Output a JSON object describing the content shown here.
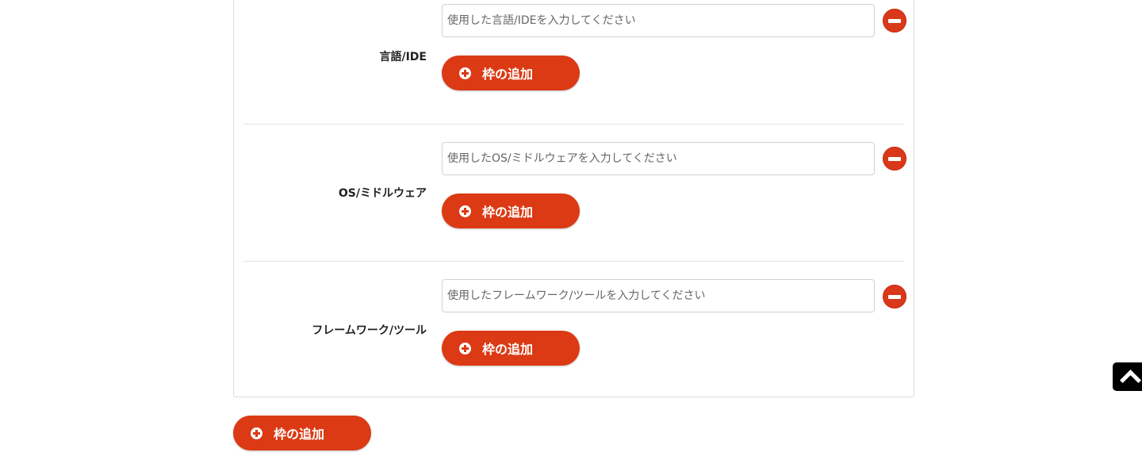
{
  "sections": [
    {
      "label": "言語/IDE",
      "placeholder": "使用した言語/IDEを入力してください",
      "add_label": "枠の追加"
    },
    {
      "label": "OS/ミドルウェア",
      "placeholder": "使用したOS/ミドルウェアを入力してください",
      "add_label": "枠の追加"
    },
    {
      "label": "フレームワーク/ツール",
      "placeholder": "使用したフレームワーク/ツールを入力してください",
      "add_label": "枠の追加"
    }
  ],
  "footer": {
    "add_label": "枠の追加"
  },
  "icons": {
    "remove": "minus-circle-icon",
    "add": "plus-circle-icon",
    "scroll_top": "chevron-up-icon"
  },
  "colors": {
    "accent": "#db3a14",
    "border": "#dcdcdc"
  }
}
